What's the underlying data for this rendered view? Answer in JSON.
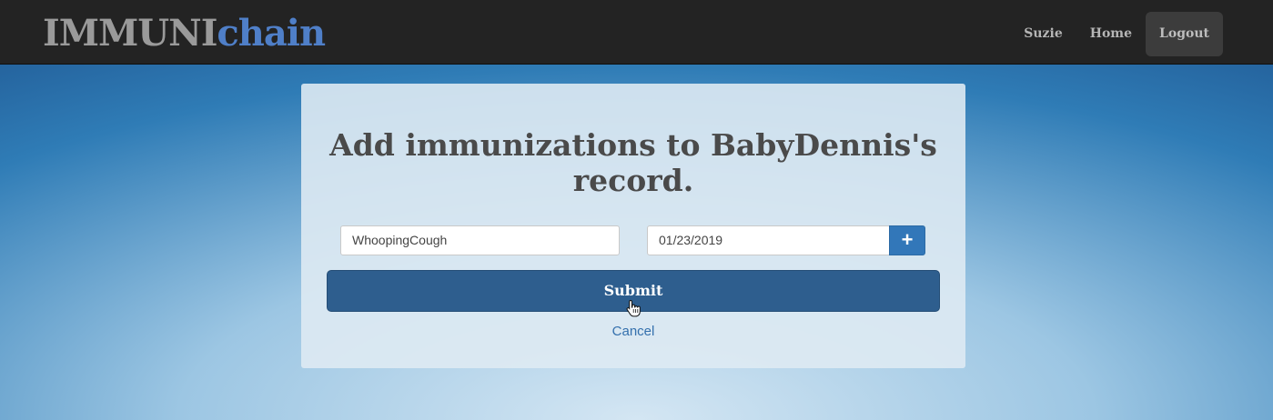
{
  "brand": {
    "part1": "IMMUNI",
    "part2": "chain"
  },
  "nav": {
    "user": "Suzie",
    "home": "Home",
    "logout": "Logout"
  },
  "form": {
    "title": "Add immunizations to BabyDennis's record.",
    "immunization_value": "WhoopingCough",
    "date_value": "01/23/2019",
    "add_symbol": "+",
    "submit_label": "Submit",
    "cancel_label": "Cancel"
  },
  "colors": {
    "navbar": "#232323",
    "brand_gray": "#9a9a9a",
    "brand_blue": "#4f7fc8",
    "submit": "#2e5e8e",
    "plus_button": "#3277b9",
    "link": "#3470ad"
  },
  "icons": {
    "add": "plus-icon",
    "cursor": "hand-pointer-icon"
  }
}
